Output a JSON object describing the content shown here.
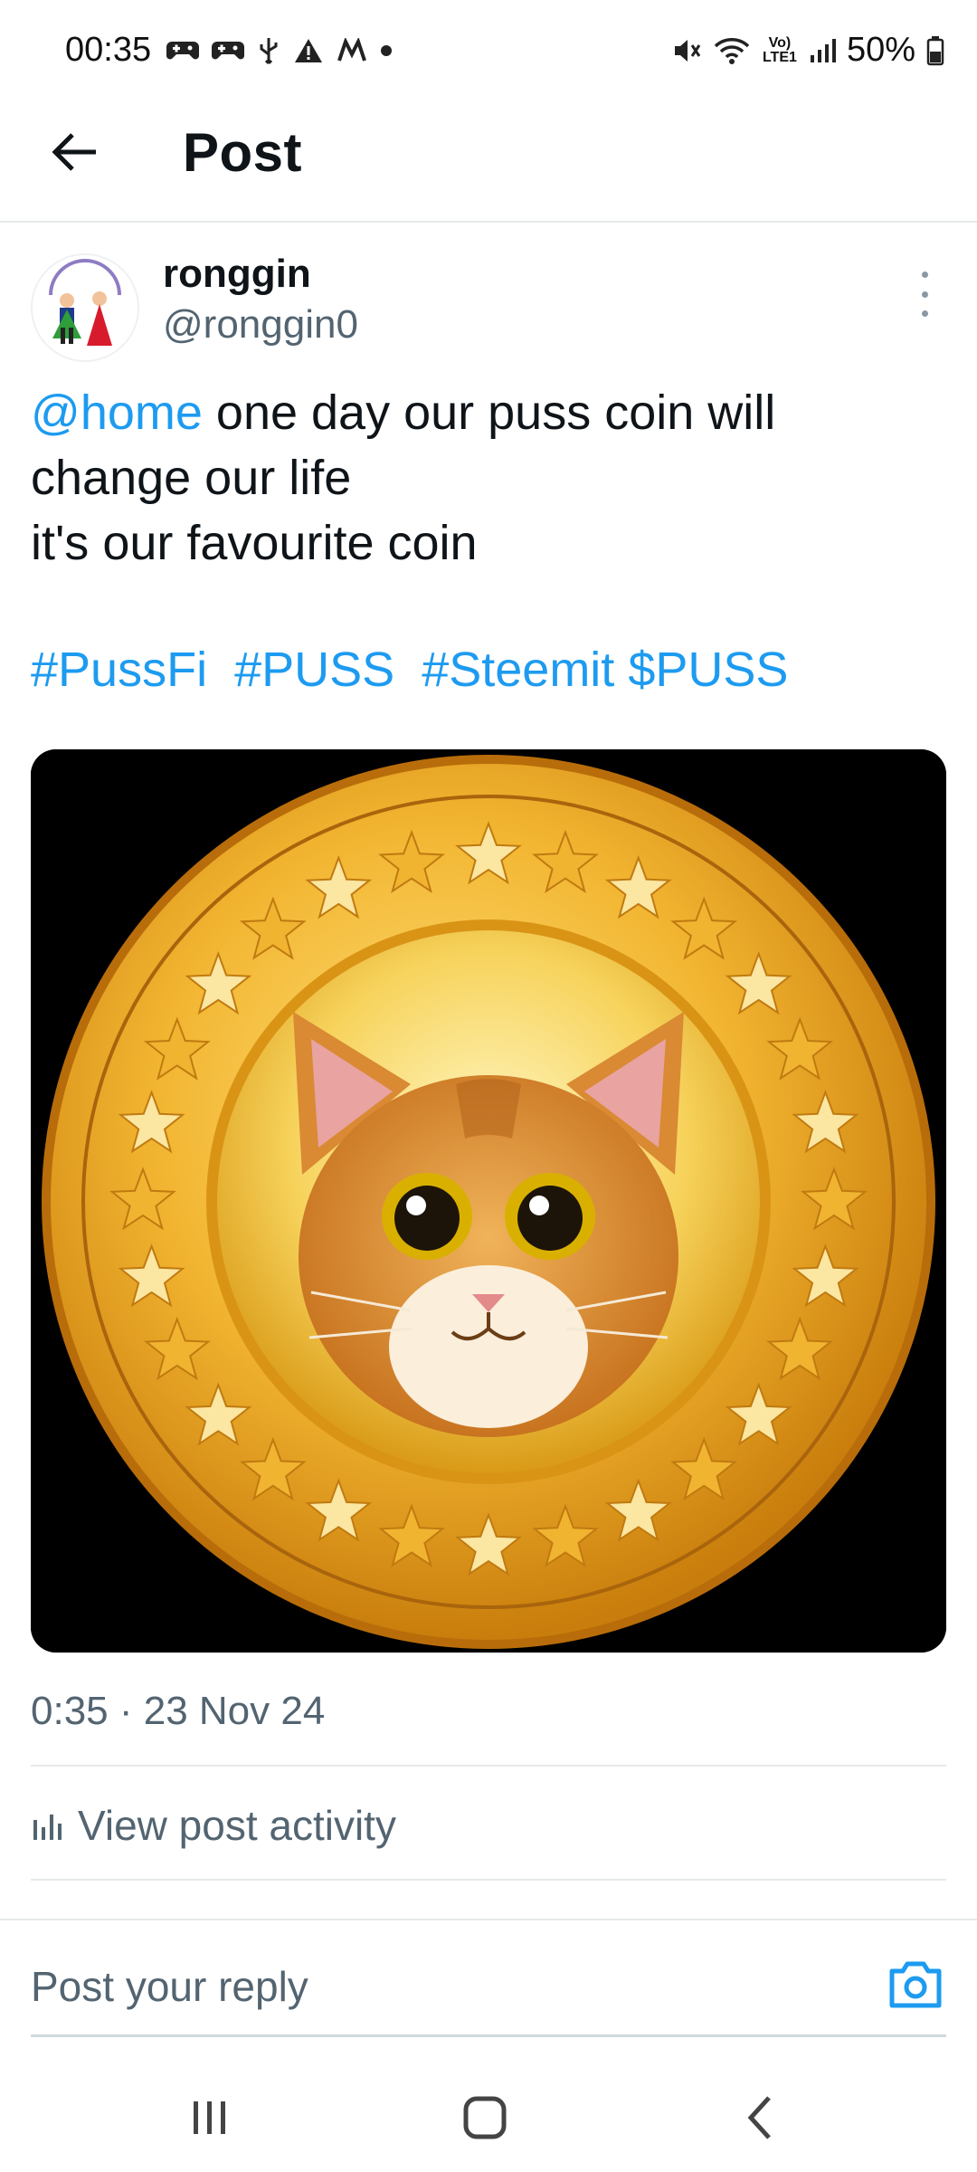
{
  "status_bar": {
    "time": "00:35",
    "battery": "50%",
    "network_label": "Vo) LTE1",
    "icons_left": [
      "game-controller-icon",
      "game-controller-icon",
      "usb-icon",
      "warning-icon",
      "m-icon",
      "dot-icon"
    ],
    "icons_right": [
      "mute-icon",
      "wifi-icon",
      "volte-icon",
      "signal-icon",
      "battery-icon"
    ]
  },
  "header": {
    "title": "Post"
  },
  "post": {
    "author_name": "ronggin",
    "author_handle": "@ronggin0",
    "mention": "@home",
    "text_line1_rest": " one day our puss coin will",
    "text_line2": "change our life",
    "text_line3": "it's our favourite coin",
    "hashtags": [
      "#PussFi",
      "#PUSS",
      "#Steemit",
      "$PUSS"
    ],
    "timestamp": "0:35 · 23 Nov 24",
    "view_activity": "View post activity"
  },
  "reply": {
    "placeholder": "Post your reply"
  },
  "colors": {
    "link": "#1d9bf0",
    "secondary_text": "#536471",
    "coin_gold": "#e9a520"
  }
}
